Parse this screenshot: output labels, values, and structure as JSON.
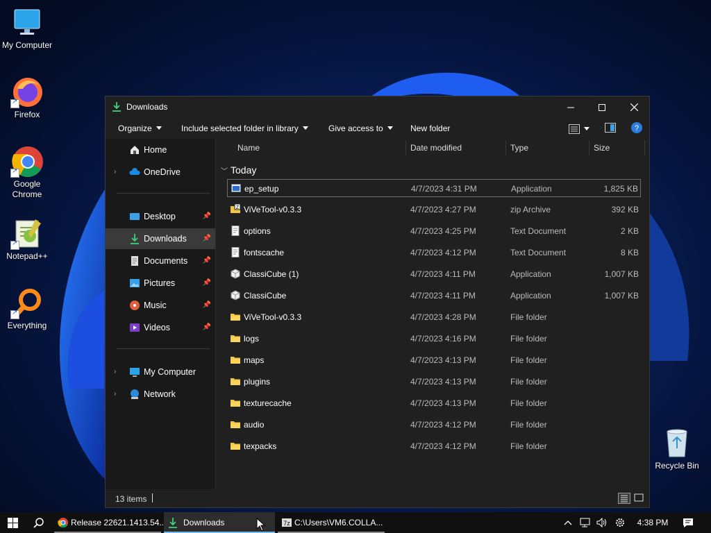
{
  "desktop": {
    "icons": [
      {
        "label": "My Computer"
      },
      {
        "label": "Firefox"
      },
      {
        "label": "Google Chrome"
      },
      {
        "label": "Notepad++"
      },
      {
        "label": "Everything"
      },
      {
        "label": "Recycle Bin"
      }
    ]
  },
  "window": {
    "title": "Downloads",
    "toolbar": {
      "organize": "Organize",
      "include": "Include selected folder in library",
      "give_access": "Give access to",
      "new_folder": "New folder"
    },
    "nav": {
      "items": [
        {
          "label": "Home"
        },
        {
          "label": "OneDrive"
        },
        {
          "label": "Desktop"
        },
        {
          "label": "Downloads"
        },
        {
          "label": "Documents"
        },
        {
          "label": "Pictures"
        },
        {
          "label": "Music"
        },
        {
          "label": "Videos"
        },
        {
          "label": "My Computer"
        },
        {
          "label": "Network"
        }
      ]
    },
    "columns": {
      "name": "Name",
      "date": "Date modified",
      "type": "Type",
      "size": "Size"
    },
    "group": "Today",
    "files": [
      {
        "name": "ep_setup",
        "date": "4/7/2023 4:31 PM",
        "type": "Application",
        "size": "1,825 KB"
      },
      {
        "name": "ViVeTool-v0.3.3",
        "date": "4/7/2023 4:27 PM",
        "type": "zip Archive",
        "size": "392 KB"
      },
      {
        "name": "options",
        "date": "4/7/2023 4:25 PM",
        "type": "Text Document",
        "size": "2 KB"
      },
      {
        "name": "fontscache",
        "date": "4/7/2023 4:12 PM",
        "type": "Text Document",
        "size": "8 KB"
      },
      {
        "name": "ClassiCube (1)",
        "date": "4/7/2023 4:11 PM",
        "type": "Application",
        "size": "1,007 KB"
      },
      {
        "name": "ClassiCube",
        "date": "4/7/2023 4:11 PM",
        "type": "Application",
        "size": "1,007 KB"
      },
      {
        "name": "ViVeTool-v0.3.3",
        "date": "4/7/2023 4:28 PM",
        "type": "File folder",
        "size": ""
      },
      {
        "name": "logs",
        "date": "4/7/2023 4:16 PM",
        "type": "File folder",
        "size": ""
      },
      {
        "name": "maps",
        "date": "4/7/2023 4:13 PM",
        "type": "File folder",
        "size": ""
      },
      {
        "name": "plugins",
        "date": "4/7/2023 4:13 PM",
        "type": "File folder",
        "size": ""
      },
      {
        "name": "texturecache",
        "date": "4/7/2023 4:13 PM",
        "type": "File folder",
        "size": ""
      },
      {
        "name": "audio",
        "date": "4/7/2023 4:12 PM",
        "type": "File folder",
        "size": ""
      },
      {
        "name": "texpacks",
        "date": "4/7/2023 4:12 PM",
        "type": "File folder",
        "size": ""
      }
    ],
    "status": {
      "items": "13 items"
    }
  },
  "taskbar": {
    "tasks": [
      {
        "label": "Release 22621.1413.54..."
      },
      {
        "label": "Downloads"
      },
      {
        "label": "C:\\Users\\VM6.COLLA..."
      }
    ],
    "clock": "4:38 PM"
  },
  "colors": {
    "accent": "#76b9ed",
    "folder": "#f4c542",
    "window_bg": "#202020"
  }
}
